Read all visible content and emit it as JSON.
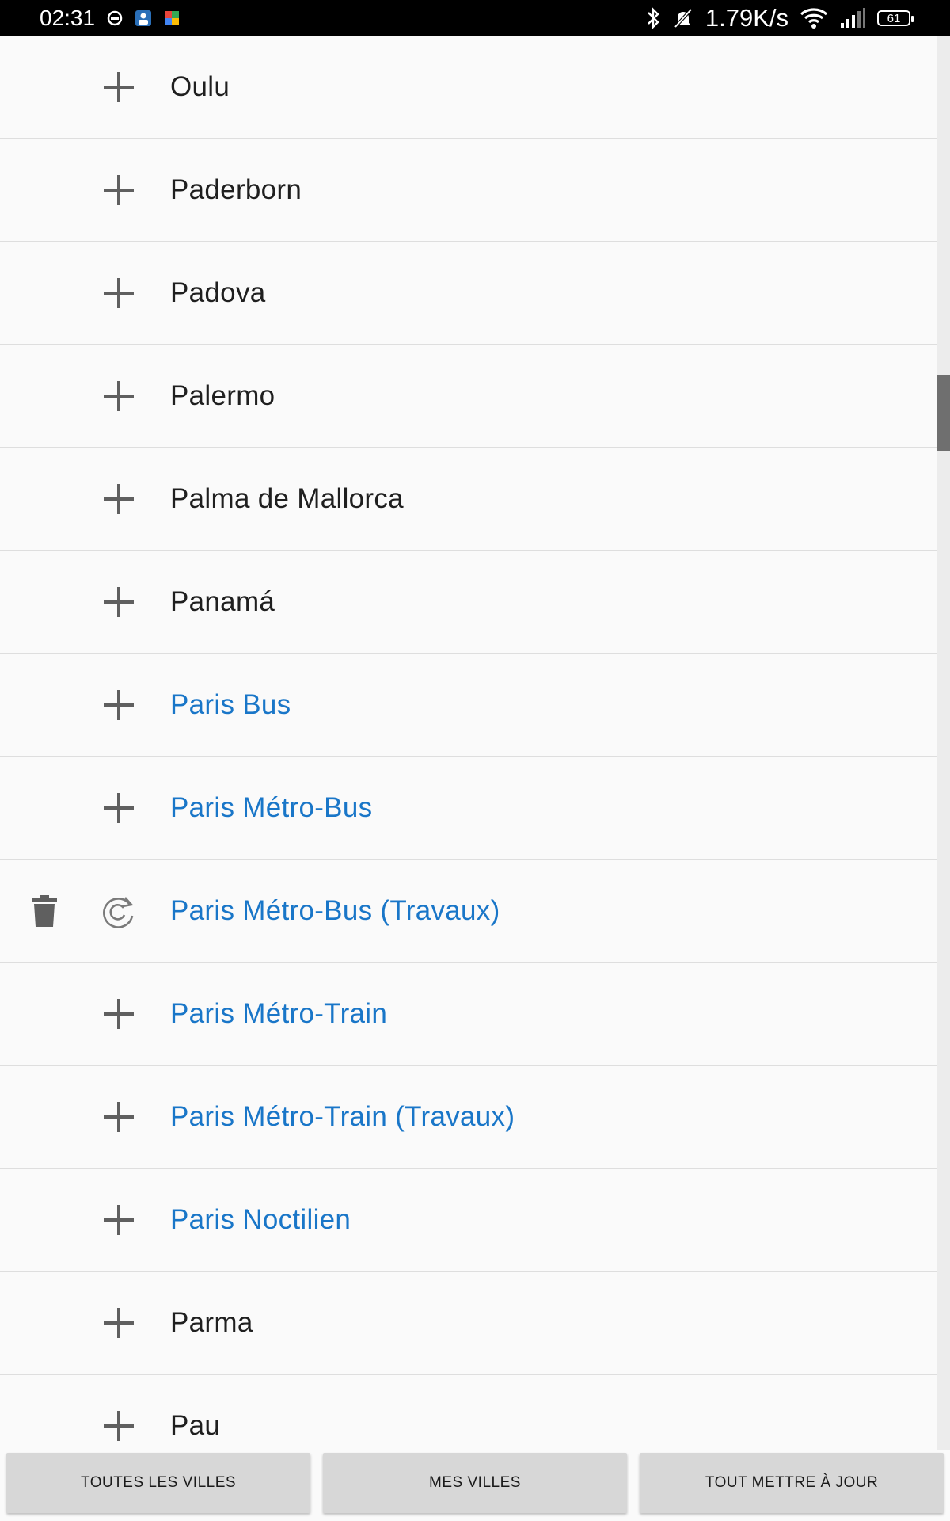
{
  "status_bar": {
    "time": "02:31",
    "net_speed": "1.79K/s",
    "battery": "61"
  },
  "cities": [
    {
      "name": "Oulu",
      "selected": false
    },
    {
      "name": "Paderborn",
      "selected": false
    },
    {
      "name": "Padova",
      "selected": false
    },
    {
      "name": "Palermo",
      "selected": false
    },
    {
      "name": "Palma de Mallorca",
      "selected": false
    },
    {
      "name": "Panamá",
      "selected": false
    },
    {
      "name": "Paris Bus",
      "selected": false
    },
    {
      "name": "Paris Métro-Bus",
      "selected": false
    },
    {
      "name": "Paris Métro-Bus (Travaux)",
      "selected": true
    },
    {
      "name": "Paris Métro-Train",
      "selected": false
    },
    {
      "name": "Paris Métro-Train (Travaux)",
      "selected": false
    },
    {
      "name": "Paris Noctilien",
      "selected": false
    },
    {
      "name": "Parma",
      "selected": false
    },
    {
      "name": "Pau",
      "selected": false
    }
  ],
  "colors": {
    "link_blue": "#1976c8",
    "text_dark": "#1f1f1f",
    "icon_gray": "#5f5f5f"
  },
  "buttons": {
    "all_cities": "TOUTES LES VILLES",
    "my_cities": "MES VILLES",
    "update_all": "TOUT METTRE À JOUR"
  }
}
